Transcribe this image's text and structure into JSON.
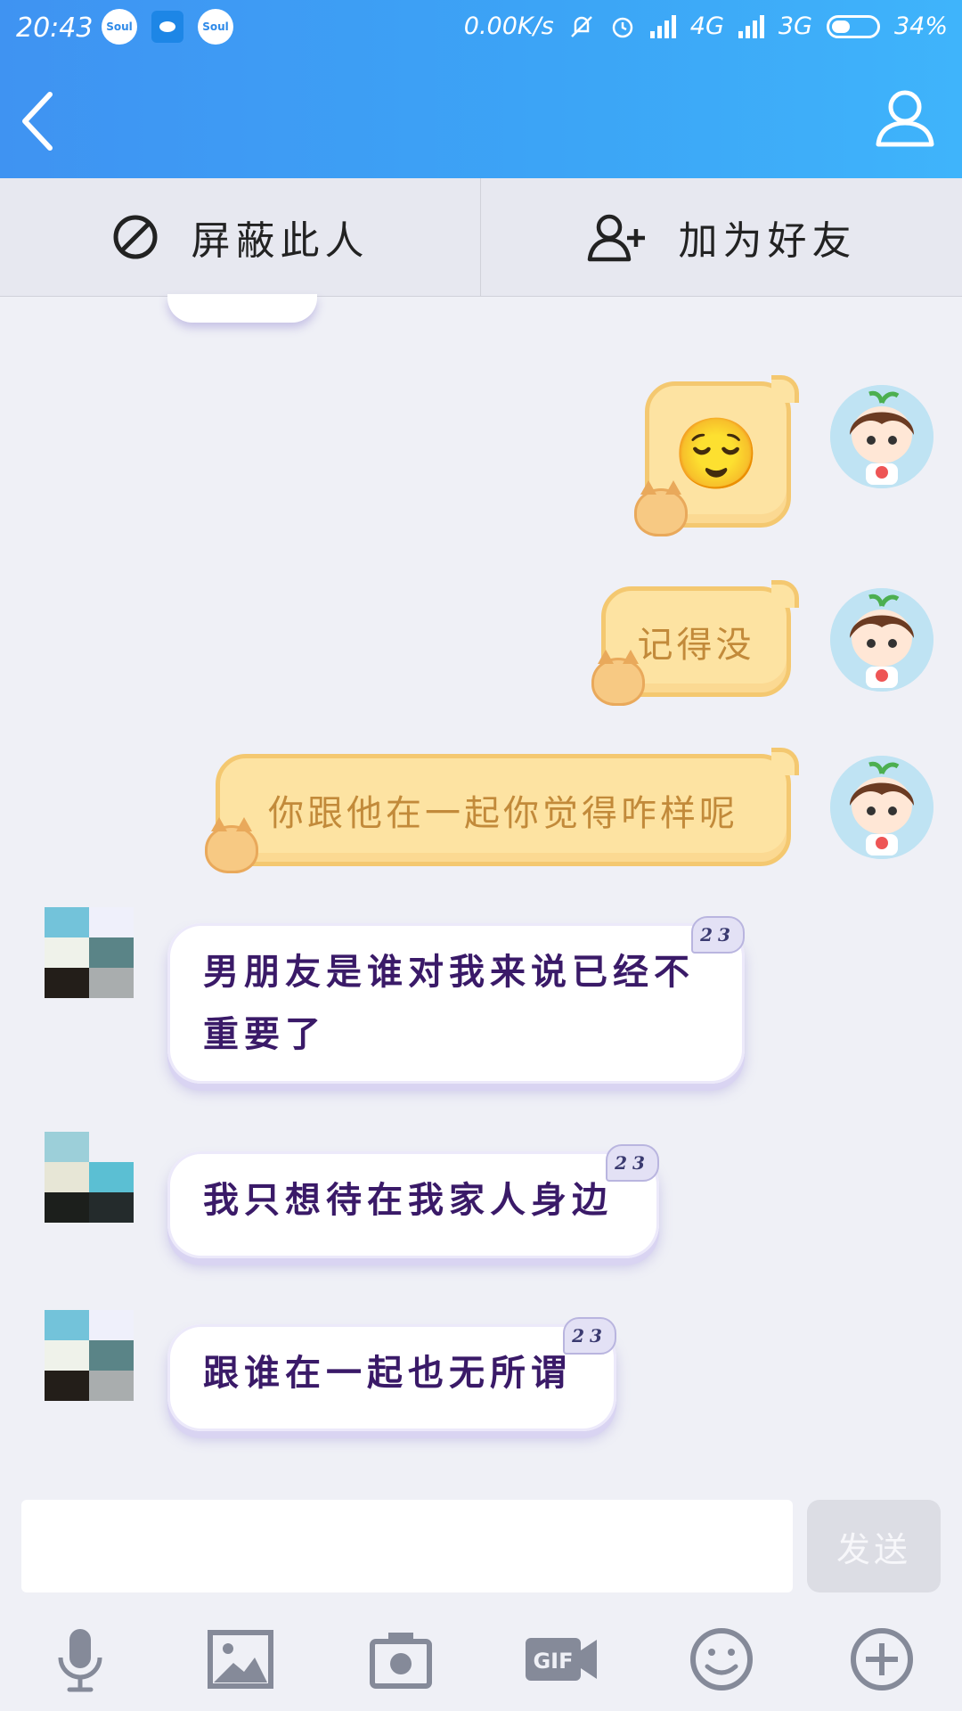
{
  "status_bar": {
    "time": "20:43",
    "app_badges": [
      "Soul",
      "Soul"
    ],
    "network_speed": "0.00K/s",
    "network_1": "4G",
    "network_2": "3G",
    "battery": "34%"
  },
  "header": {
    "back_icon": "chevron-left-icon",
    "profile_icon": "person-icon",
    "bar_color": "#3ca5f6"
  },
  "actions": {
    "block_label": "屏蔽此人",
    "block_icon": "ban-icon",
    "add_friend_label": "加为好友",
    "add_friend_icon": "add-user-icon"
  },
  "messages": [
    {
      "side": "mine",
      "type": "emoji",
      "emoji": "😌"
    },
    {
      "side": "mine",
      "type": "text",
      "text": "记得没"
    },
    {
      "side": "mine",
      "type": "text",
      "text": "你跟他在一起你觉得咋样呢"
    },
    {
      "side": "other",
      "type": "text",
      "level": "23",
      "lines": [
        "男朋友是谁对我来说已经不",
        "重要了"
      ]
    },
    {
      "side": "other",
      "type": "text",
      "level": "23",
      "text": "我只想待在我家人身边"
    },
    {
      "side": "other",
      "type": "text",
      "level": "23",
      "text": "跟谁在一起也无所谓"
    }
  ],
  "input": {
    "placeholder": "",
    "send_label": "发送"
  },
  "toolbar": [
    {
      "icon": "microphone-icon"
    },
    {
      "icon": "image-icon"
    },
    {
      "icon": "camera-icon"
    },
    {
      "icon": "gif-icon",
      "label": "GIF"
    },
    {
      "icon": "emoji-icon"
    },
    {
      "icon": "plus-icon"
    }
  ]
}
